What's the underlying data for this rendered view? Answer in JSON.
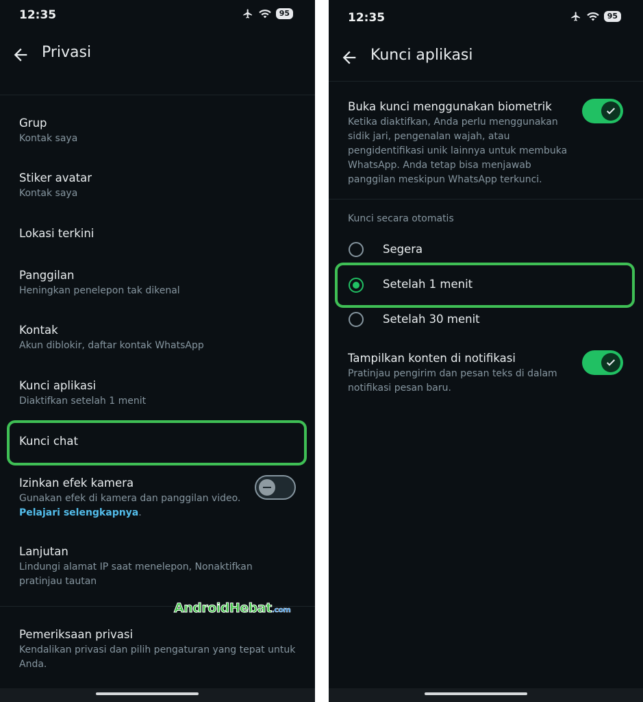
{
  "left": {
    "status_time": "12:35",
    "battery": "95",
    "title": "Privasi",
    "items": [
      {
        "title": "Grup",
        "subtitle": "Kontak saya"
      },
      {
        "title": "Stiker avatar",
        "subtitle": "Kontak saya"
      },
      {
        "title": "Lokasi terkini"
      },
      {
        "title": "Panggilan",
        "subtitle": "Heningkan penelepon tak dikenal"
      },
      {
        "title": "Kontak",
        "subtitle": "Akun diblokir, daftar kontak WhatsApp"
      },
      {
        "title": "Kunci aplikasi",
        "subtitle": "Diaktifkan setelah 1 menit"
      },
      {
        "title": "Kunci chat"
      },
      {
        "title": "Izinkan efek kamera",
        "subtitle": "Gunakan efek di kamera dan panggilan video.",
        "link": "Pelajari selengkapnya",
        "toggle": false
      },
      {
        "title": "Lanjutan",
        "subtitle_line1": "Lindungi alamat IP saat menelepon, Nonaktifkan",
        "subtitle_line2": "pratinjau tautan"
      },
      {
        "title": "Pemeriksaan privasi",
        "subtitle_line1": "Kendalikan privasi dan pilih pengaturan yang tepat untuk",
        "subtitle_line2": "Anda."
      }
    ],
    "watermark_main": "AndroidHebat",
    "watermark_suffix": ".com"
  },
  "right": {
    "status_time": "12:35",
    "battery": "95",
    "title": "Kunci aplikasi",
    "biometric": {
      "title": "Buka kunci menggunakan biometrik",
      "desc_lines": [
        "Ketika diaktifkan, Anda perlu menggunakan",
        "sidik jari, pengenalan wajah, atau",
        "pengidentifikasi unik lainnya untuk membuka",
        "WhatsApp. Anda tetap bisa menjawab",
        "panggilan meskipun WhatsApp terkunci."
      ],
      "toggle": true
    },
    "auto_lock_label": "Kunci secara otomatis",
    "options": [
      {
        "label": "Segera",
        "selected": false
      },
      {
        "label": "Setelah 1 menit",
        "selected": true
      },
      {
        "label": "Setelah 30 menit",
        "selected": false
      }
    ],
    "notif": {
      "title": "Tampilkan konten di notifikasi",
      "desc_lines": [
        "Pratinjau pengirim dan pesan teks di dalam",
        "notifikasi pesan baru."
      ],
      "toggle": true
    }
  },
  "colors": {
    "accent": "#21c063",
    "highlight": "#3fbf55",
    "background": "#0b1014",
    "link": "#53bdeb"
  }
}
